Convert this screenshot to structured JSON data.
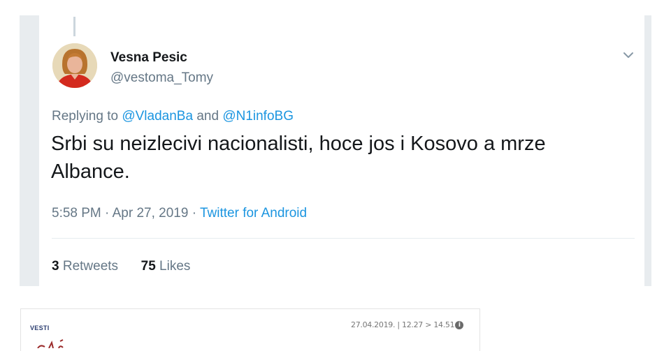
{
  "tweet": {
    "display_name": "Vesna Pesic",
    "handle": "@vestoma_Tomy",
    "replying_prefix": "Replying to",
    "reply_user_1": "@VladanBa",
    "reply_and": "and",
    "reply_user_2": "@N1infoBG",
    "text": "Srbi su neizlecivi nacionalisti, hoce jos i Kosovo a mrze Albance.",
    "time": "5:58 PM",
    "separator": "·",
    "date": "Apr 27, 2019",
    "source": "Twitter for Android",
    "retweets_count": "3",
    "retweets_label": "Retweets",
    "likes_count": "75",
    "likes_label": "Likes",
    "menu_icon": "chevron-down-icon"
  },
  "article_preview": {
    "logo": "VESTI",
    "date": "27.04.2019.",
    "pipe": "|",
    "time_from": "12.27",
    "arrow": ">",
    "time_to": "14.51",
    "info_icon_glyph": "i"
  },
  "colors": {
    "link": "#1b95e0",
    "muted": "#657786",
    "text": "#14171a",
    "strip": "#e8ecef"
  }
}
